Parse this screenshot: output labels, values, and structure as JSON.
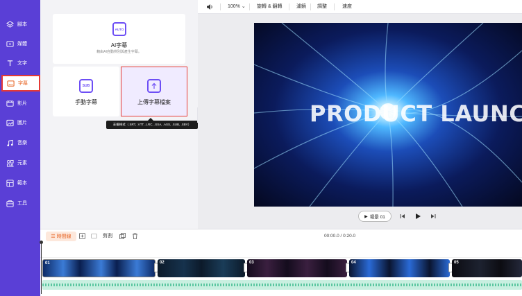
{
  "sidebar": {
    "items": [
      {
        "label": "腳本",
        "icon": "layers-icon"
      },
      {
        "label": "媒體",
        "icon": "media-icon"
      },
      {
        "label": "文字",
        "icon": "text-icon"
      },
      {
        "label": "字幕",
        "icon": "subtitle-icon",
        "active": true
      },
      {
        "label": "影片",
        "icon": "video-icon"
      },
      {
        "label": "圖片",
        "icon": "image-icon"
      },
      {
        "label": "音樂",
        "icon": "music-icon"
      },
      {
        "label": "元素",
        "icon": "elements-icon"
      },
      {
        "label": "範本",
        "icon": "template-icon"
      },
      {
        "label": "工具",
        "icon": "tools-icon"
      }
    ]
  },
  "panel": {
    "ai_card": {
      "icon_text": "AUTO",
      "title": "AI字幕",
      "subtitle": "藉由AI自動辨別與產生字幕。"
    },
    "manual_card": {
      "icon_text": "SUB",
      "title": "手動字幕"
    },
    "upload_card": {
      "title": "上傳字幕檔案"
    },
    "tooltip": "支援格式（.SRT, .VTT, .LRC, .SSA, .ASS, .SUB, .SBV）"
  },
  "toolbar": {
    "zoom": "100%",
    "rotate_flip": "旋轉 & 翻轉",
    "filters": "濾鏡",
    "adjust": "調整",
    "speed": "速度"
  },
  "preview": {
    "title_text": "PRODUCT LAUNCH",
    "scene_label": "場景 01"
  },
  "timeline": {
    "timeline_label": "時間線",
    "split_label": "剪割",
    "time": "00:00.0 / 0:20.0",
    "clips": [
      "01",
      "02",
      "03",
      "04",
      "05"
    ]
  },
  "colors": {
    "sidebar_bg": "#5a3fd6",
    "accent": "#6d4ef5",
    "highlight_border": "#e53935",
    "timeline_accent": "#e8692b"
  }
}
